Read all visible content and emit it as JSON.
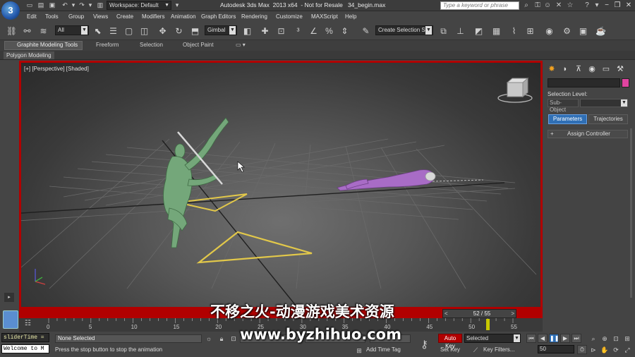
{
  "title_bar": {
    "workspace": "Workspace: Default",
    "title": "Autodesk 3ds Max  2013 x64  - Not for Resale   34_begin.max",
    "search_placeholder": "Type a keyword or phrase"
  },
  "menu": [
    "Edit",
    "Tools",
    "Group",
    "Views",
    "Create",
    "Modifiers",
    "Animation",
    "Graph Editors",
    "Rendering",
    "Customize",
    "MAXScript",
    "Help"
  ],
  "toolbar": {
    "filter": "All",
    "ref_coord": "Gimbal",
    "named_selection": "Create Selection Se"
  },
  "ribbon": {
    "tabs": [
      "Graphite Modeling Tools",
      "Freeform",
      "Selection",
      "Object Paint"
    ],
    "panel": "Polygon Modeling"
  },
  "viewport": {
    "label": "[+] [Perspective] [Shaded]"
  },
  "command_panel": {
    "selection_level": "Selection Level:",
    "sub_object": "Sub-Object",
    "parameters": "Parameters",
    "trajectories": "Trajectories",
    "rollout": "Assign Controller",
    "rollout_toggle": "+"
  },
  "time_slider": {
    "frame": "52 / 55",
    "prev": "<",
    "next": ">"
  },
  "track_bar": {
    "ticks": [
      "0",
      "5",
      "10",
      "15",
      "20",
      "25",
      "30",
      "35",
      "40",
      "45",
      "50",
      "55"
    ],
    "current_frame": 52
  },
  "status": {
    "listener_top": "sliderTime =",
    "listener_bottom": "Welcome to M",
    "selection": "None Selected",
    "prompt": "Press the stop button to stop the animation",
    "add_time_tag": "Add Time Tag",
    "auto_key": "Auto Key",
    "set_key": "Set Key",
    "selected": "Selected",
    "key_filters": "Key Filters...",
    "frame": "50"
  },
  "watermark": {
    "chinese": "不移之火-动漫游戏美术资源",
    "url": "www.byzhihuo.com"
  },
  "colors": {
    "active_border": "#b10000",
    "auto_key": "#b10000",
    "object_color": "#e044a0",
    "parameters_tab": "#2f6fb5"
  }
}
